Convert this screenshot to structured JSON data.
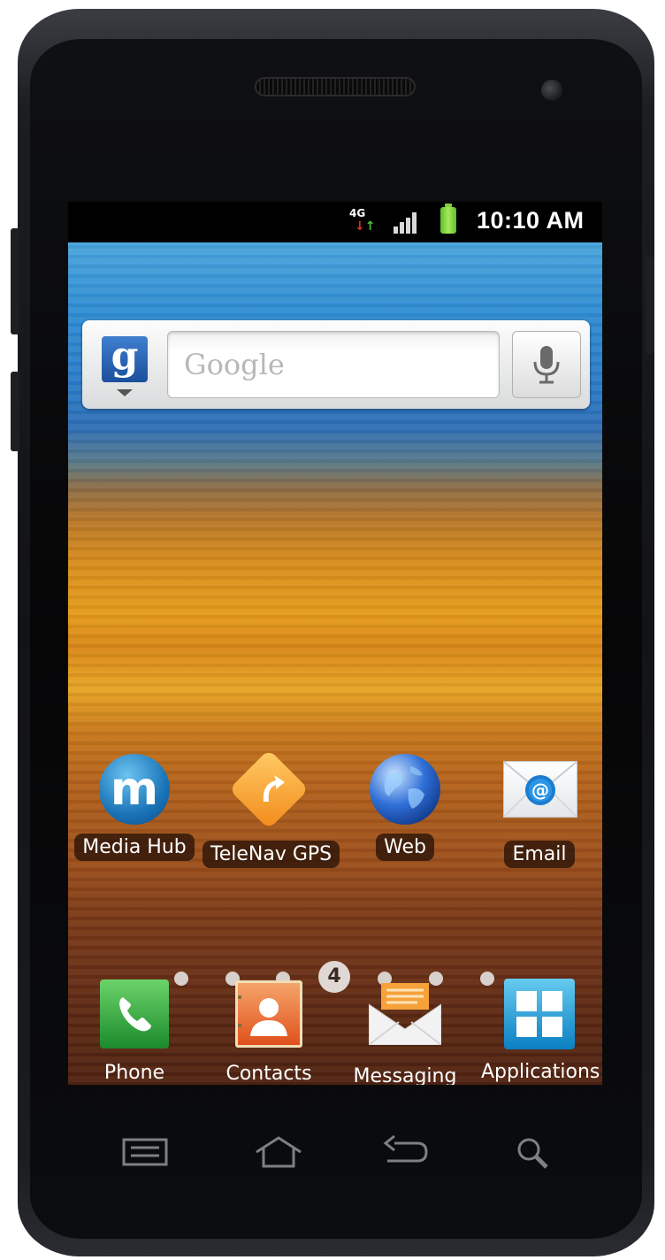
{
  "status_bar": {
    "network": "4G",
    "time": "10:10 AM"
  },
  "search_widget": {
    "logo": "g",
    "placeholder": "Google",
    "icons": [
      "google-logo-icon",
      "dropdown-caret-icon",
      "microphone-icon"
    ]
  },
  "home_apps": [
    {
      "label": "Media Hub",
      "icon": "media-hub-icon"
    },
    {
      "label": "TeleNav GPS",
      "icon": "telenav-gps-icon"
    },
    {
      "label": "Web",
      "icon": "globe-icon"
    },
    {
      "label": "Email",
      "icon": "email-envelope-icon"
    }
  ],
  "pager": {
    "current": "4",
    "total_dots": 7,
    "current_index": 3
  },
  "dock_apps": [
    {
      "label": "Phone",
      "icon": "phone-icon"
    },
    {
      "label": "Contacts",
      "icon": "contacts-icon"
    },
    {
      "label": "Messaging",
      "icon": "messaging-icon"
    },
    {
      "label": "Applications",
      "icon": "applications-grid-icon"
    }
  ],
  "hardware_keys": [
    "menu-key-icon",
    "home-key-icon",
    "back-key-icon",
    "search-key-icon"
  ],
  "colors": {
    "status_bar_bg": "#000000",
    "battery": "#7ed23f",
    "label_bg": "#2b1408"
  }
}
